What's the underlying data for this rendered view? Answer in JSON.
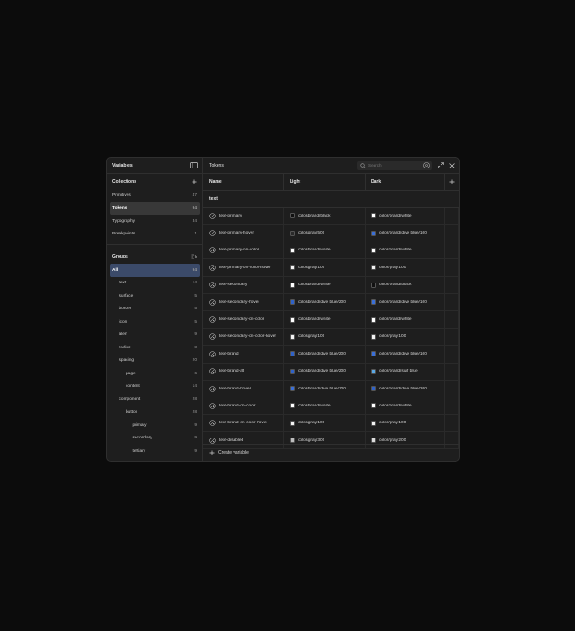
{
  "sidebar": {
    "title": "Variables",
    "collections_label": "Collections",
    "collections": [
      {
        "label": "Primitives",
        "count": "47"
      },
      {
        "label": "Tokens",
        "count": "94"
      },
      {
        "label": "Typography",
        "count": "34"
      },
      {
        "label": "Breakpoints",
        "count": "1"
      }
    ],
    "groups_label": "Groups",
    "groups": [
      {
        "label": "All",
        "count": "94",
        "indent": 0
      },
      {
        "label": "text",
        "count": "14",
        "indent": 1
      },
      {
        "label": "surface",
        "count": "5",
        "indent": 1
      },
      {
        "label": "border",
        "count": "5",
        "indent": 1
      },
      {
        "label": "icon",
        "count": "5",
        "indent": 1
      },
      {
        "label": "alert",
        "count": "9",
        "indent": 1
      },
      {
        "label": "radius",
        "count": "8",
        "indent": 1
      },
      {
        "label": "spacing",
        "count": "20",
        "indent": 1
      },
      {
        "label": "page",
        "count": "6",
        "indent": 2
      },
      {
        "label": "content",
        "count": "14",
        "indent": 2
      },
      {
        "label": "component",
        "count": "28",
        "indent": 1
      },
      {
        "label": "button",
        "count": "28",
        "indent": 2
      },
      {
        "label": "primary",
        "count": "9",
        "indent": 3
      },
      {
        "label": "secondary",
        "count": "9",
        "indent": 3
      },
      {
        "label": "tertiary",
        "count": "9",
        "indent": 3
      }
    ]
  },
  "main": {
    "title": "Tokens",
    "search_placeholder": "Search",
    "columns": {
      "name": "Name",
      "light": "Light",
      "dark": "Dark"
    },
    "group_title": "text",
    "rows": [
      {
        "name": "text-primary",
        "light": "color/brand/black",
        "light_color": "#111111",
        "dark": "color/brand/white",
        "dark_color": "#ffffff"
      },
      {
        "name": "text-primary-hover",
        "light": "color/gray/500",
        "light_color": "#2a2a2a",
        "dark": "color/brand/dive blue/100",
        "dark_color": "#3a6fd8"
      },
      {
        "name": "text-primary-on-color",
        "light": "color/brand/white",
        "light_color": "#ffffff",
        "dark": "color/brand/white",
        "dark_color": "#ffffff"
      },
      {
        "name": "text-primary-on-color-hover",
        "light": "color/gray/100",
        "light_color": "#f2f2f2",
        "dark": "color/gray/100",
        "dark_color": "#f2f2f2"
      },
      {
        "name": "text-secondary",
        "light": "color/brand/white",
        "light_color": "#ffffff",
        "dark": "color/brand/black",
        "dark_color": "#111111"
      },
      {
        "name": "text-secondary-hover",
        "light": "color/brand/dive blue/200",
        "light_color": "#2f62c9",
        "dark": "color/brand/dive blue/100",
        "dark_color": "#3a6fd8"
      },
      {
        "name": "text-secondary-on-color",
        "light": "color/brand/white",
        "light_color": "#ffffff",
        "dark": "color/brand/white",
        "dark_color": "#ffffff"
      },
      {
        "name": "text-secondary-on-color-hover",
        "light": "color/gray/100",
        "light_color": "#f2f2f2",
        "dark": "color/gray/100",
        "dark_color": "#f2f2f2"
      },
      {
        "name": "text-brand",
        "light": "color/brand/dive blue/200",
        "light_color": "#2f62c9",
        "dark": "color/brand/dive blue/100",
        "dark_color": "#3a6fd8"
      },
      {
        "name": "text-brand-alt",
        "light": "color/brand/dive blue/200",
        "light_color": "#2f62c9",
        "dark": "color/brand/surf blue",
        "dark_color": "#5aa9e6"
      },
      {
        "name": "text-brand-hover",
        "light": "color/brand/dive blue/100",
        "light_color": "#3a6fd8",
        "dark": "color/brand/dive blue/200",
        "dark_color": "#2f62c9"
      },
      {
        "name": "text-brand-on-color",
        "light": "color/brand/white",
        "light_color": "#ffffff",
        "dark": "color/brand/white",
        "dark_color": "#ffffff"
      },
      {
        "name": "text-brand-on-color-hover",
        "light": "color/gray/100",
        "light_color": "#f2f2f2",
        "dark": "color/gray/100",
        "dark_color": "#f2f2f2"
      },
      {
        "name": "text-disabled",
        "light": "color/gray/300",
        "light_color": "#bdbdbd",
        "dark": "color/gray/200",
        "dark_color": "#dcdcdc"
      }
    ],
    "create_label": "Create variable"
  }
}
